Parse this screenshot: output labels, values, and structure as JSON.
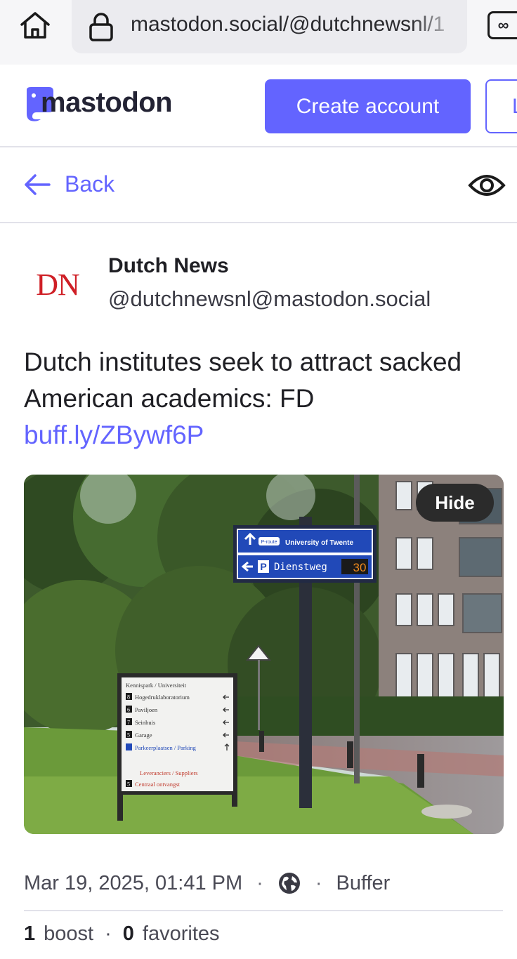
{
  "browser": {
    "url": "mastodon.social/@dutchnewsnl/1",
    "tabs_icon": "∞"
  },
  "header": {
    "logo_text": "mastodon",
    "create_account_label": "Create account",
    "login_label": "L"
  },
  "nav": {
    "back_label": "Back"
  },
  "account": {
    "avatar_text": "DN",
    "display_name": "Dutch News",
    "acct": "@dutchnewsnl@mastodon.social"
  },
  "status": {
    "text": "Dutch institutes seek to attract sacked American academics: FD",
    "link": "buff.ly/ZBywf6P",
    "hide_label": "Hide"
  },
  "image_text": {
    "route_badge": "P-route",
    "sign_top": "University of Twente",
    "sign_p": "P",
    "sign_bottom": "Dienstweg",
    "sign_count": "30",
    "board_title": "Kennispark / Universiteit",
    "board_rows": [
      {
        "num": "8",
        "label": "Hogedruklaboratorium"
      },
      {
        "num": "6",
        "label": "Paviljoen"
      },
      {
        "num": "7",
        "label": "Seinhuis"
      },
      {
        "num": "5",
        "label": "Garage"
      },
      {
        "num": "",
        "label": "Parkeerplaatsen / Parking"
      }
    ],
    "board_supplier": "Leveranciers / Suppliers",
    "board_last_num": "5",
    "board_last": "Centraal ontvangst"
  },
  "meta": {
    "date": "Mar 19, 2025, 01:41 PM",
    "application": "Buffer"
  },
  "stats": {
    "boosts_count": "1",
    "boosts_label": "boost",
    "favs_count": "0",
    "favs_label": "favorites"
  },
  "colors": {
    "accent": "#6364ff",
    "dn_red": "#cf1f26"
  }
}
